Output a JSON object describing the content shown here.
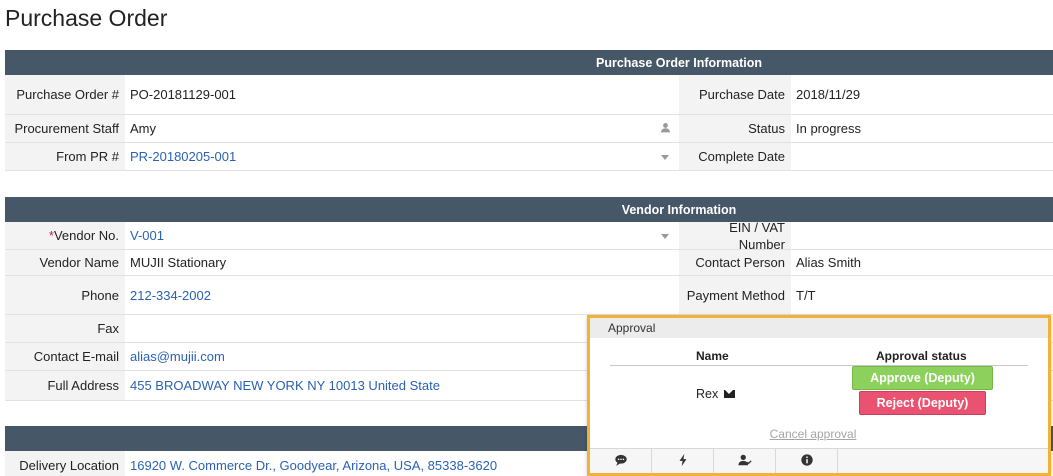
{
  "page": {
    "title": "Purchase Order"
  },
  "po_info": {
    "header": "Purchase Order Information",
    "po_number_label": "Purchase Order #",
    "po_number": "PO-20181129-001",
    "purchase_date_label": "Purchase Date",
    "purchase_date": "2018/11/29",
    "staff_label": "Procurement Staff",
    "staff": "Amy",
    "status_label": "Status",
    "status": "In progress",
    "from_pr_label": "From PR #",
    "from_pr": "PR-20180205-001",
    "complete_date_label": "Complete Date",
    "complete_date": ""
  },
  "vendor_info": {
    "header": "Vendor Information",
    "vendor_no_required": "*",
    "vendor_no_label": "Vendor No.",
    "vendor_no": "V-001",
    "ein_label": "EIN / VAT Number",
    "ein": "",
    "vendor_name_label": "Vendor Name",
    "vendor_name": "MUJII Stationary",
    "contact_person_label": "Contact Person",
    "contact_person": "Alias Smith",
    "phone_label": "Phone",
    "phone": "212-334-2002",
    "payment_method_label": "Payment Method",
    "payment_method": "T/T",
    "fax_label": "Fax",
    "fax": "",
    "email_label": "Contact E-mail",
    "email": "alias@mujii.com",
    "address_label": "Full Address",
    "address": "455 BROADWAY NEW YORK NY 10013 United State"
  },
  "delivery": {
    "location_label": "Delivery Location",
    "location": "16920 W. Commerce Dr., Goodyear, Arizona, USA, 85338-3620"
  },
  "approval": {
    "title": "Approval",
    "col_name": "Name",
    "col_status": "Approval status",
    "approver": "Rex",
    "approve_label": "Approve (Deputy)",
    "reject_label": "Reject (Deputy)",
    "cancel_label": "Cancel approval",
    "toolbar_icons": [
      "comment-icon",
      "bolt-icon",
      "user-check-icon",
      "info-icon"
    ]
  },
  "colors": {
    "section_header": "#465868",
    "link": "#2a62b3",
    "approve": "#8cd15c",
    "reject": "#e95270",
    "popup_border": "#f2b233"
  }
}
